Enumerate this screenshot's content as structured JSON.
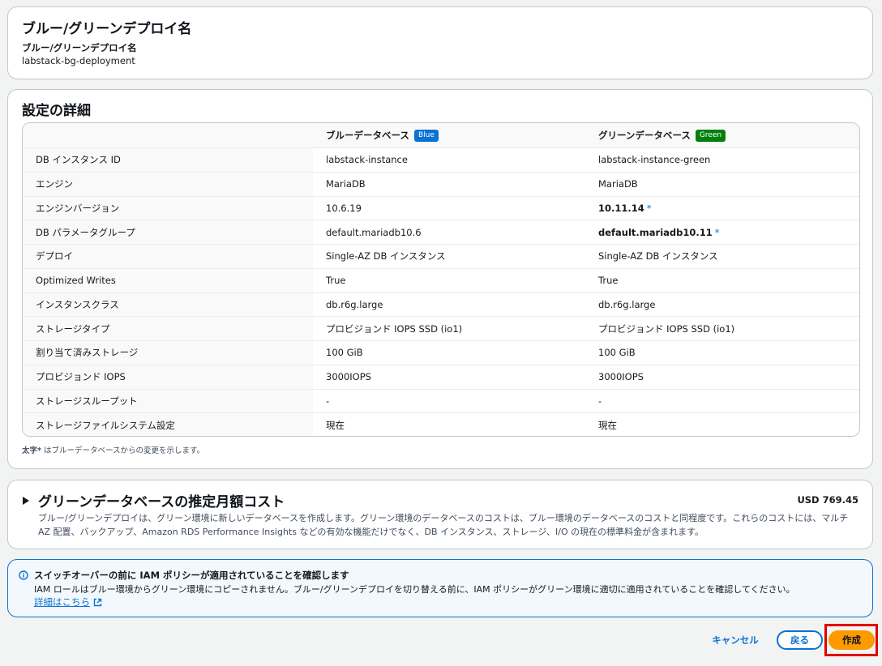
{
  "deploy_name_card": {
    "title": "ブルー/グリーンデプロイ名",
    "field_label": "ブルー/グリーンデプロイ名",
    "field_value": "labstack-bg-deployment"
  },
  "settings": {
    "title": "設定の詳細",
    "header": {
      "blue_label": "ブルーデータベース",
      "blue_badge": "Blue",
      "green_label": "グリーンデータベース",
      "green_badge": "Green"
    },
    "rows": [
      {
        "label": "DB インスタンス ID",
        "blue": "labstack-instance",
        "green": "labstack-instance-green"
      },
      {
        "label": "エンジン",
        "blue": "MariaDB",
        "green": "MariaDB"
      },
      {
        "label": "エンジンバージョン",
        "blue": "10.6.19",
        "green": "10.11.14",
        "green_mark": "*"
      },
      {
        "label": "DB パラメータグループ",
        "blue": "default.mariadb10.6",
        "green": "default.mariadb10.11",
        "green_mark": "*"
      },
      {
        "label": "デプロイ",
        "blue": "Single-AZ DB インスタンス",
        "green": "Single-AZ DB インスタンス"
      },
      {
        "label": "Optimized Writes",
        "blue": "True",
        "green": "True"
      },
      {
        "label": "インスタンスクラス",
        "blue": "db.r6g.large",
        "green": "db.r6g.large"
      },
      {
        "label": "ストレージタイプ",
        "blue": "プロビジョンド IOPS SSD (io1)",
        "green": "プロビジョンド IOPS SSD (io1)"
      },
      {
        "label": "割り当て済みストレージ",
        "blue": "100 GiB",
        "green": "100 GiB"
      },
      {
        "label": "プロビジョンド IOPS",
        "blue": "3000IOPS",
        "green": "3000IOPS"
      },
      {
        "label": "ストレージスループット",
        "blue": "-",
        "green": "-"
      },
      {
        "label": "ストレージファイルシステム設定",
        "blue": "現在",
        "green": "現在"
      }
    ],
    "footnote_bold": "太字*",
    "footnote_text": " はブルーデータベースからの変更を示します。"
  },
  "cost": {
    "title": "グリーンデータベースの推定月額コスト",
    "amount": "USD 769.45",
    "description": "ブルー/グリーンデプロイは、グリーン環境に新しいデータベースを作成します。グリーン環境のデータベースのコストは、ブルー環境のデータベースのコストと同程度です。これらのコストには、マルチ AZ 配置、バックアップ、Amazon RDS Performance Insights などの有効な機能だけでなく、DB インスタンス、ストレージ、I/O の現在の標準料金が含まれます。"
  },
  "info": {
    "title": "スイッチオーバーの前に IAM ポリシーが適用されていることを確認します",
    "body": "IAM ロールはブルー環境からグリーン環境にコピーされません。ブルー/グリーンデプロイを切り替える前に、IAM ポリシーがグリーン環境に適切に適用されていることを確認してください。",
    "link": "詳細はこちら"
  },
  "actions": {
    "cancel": "キャンセル",
    "back": "戻る",
    "create": "作成"
  },
  "colors": {
    "blue_badge": "#0972d3",
    "green_badge": "#037f0c",
    "primary_button": "#ff9900",
    "link": "#0972d3",
    "highlight": "#e00000"
  }
}
